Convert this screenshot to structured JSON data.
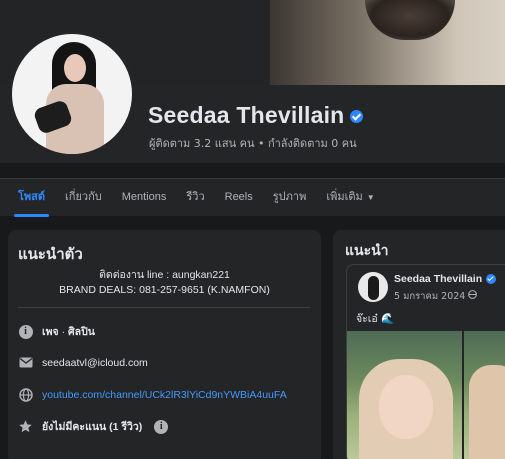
{
  "profile": {
    "name": "Seedaa Thevillain",
    "followers_text": "ผู้ติดตาม 3.2 แสน คน • กำลังติดตาม 0 คน"
  },
  "tabs": [
    {
      "label": "โพสต์",
      "active": true
    },
    {
      "label": "เกี่ยวกับ"
    },
    {
      "label": "Mentions"
    },
    {
      "label": "รีวิว"
    },
    {
      "label": "Reels"
    },
    {
      "label": "รูปภาพ"
    },
    {
      "label": "เพิ่มเติม",
      "dropdown": true
    }
  ],
  "intro": {
    "title": "แนะนำตัว",
    "bio_line1": "ติดต่องาน line : aungkan221",
    "bio_line2": "BRAND DEALS: 081-257-9651 (K.NAMFON)",
    "category_prefix": "เพจ",
    "category_sep": " · ",
    "category": "ศิลปิน",
    "email": "seedaatvl@icloud.com",
    "website": "youtube.com/channel/UCk2lR3lYiCd9nYWBiA4uuFA",
    "rating": "ยังไม่มีคะแนน (1 รีวิว)"
  },
  "featured": {
    "title": "แนะนำ",
    "post": {
      "author": "Seedaa Thevillain",
      "date": "5 มกราคม 2024",
      "text": "จ๊ะเอ๋ 🌊"
    }
  },
  "colors": {
    "accent": "#2d88ff",
    "link": "#4599ff",
    "card": "#242526",
    "background": "#18191a"
  }
}
